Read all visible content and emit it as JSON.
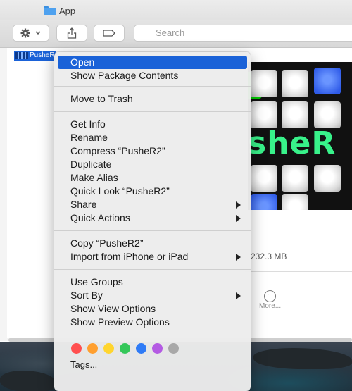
{
  "window": {
    "title": "App",
    "search_placeholder": "Search",
    "selected_file_name": "PusheR2",
    "preview_logo_text": "sheR",
    "file_size": "232.3 MB",
    "more_label": "More..."
  },
  "context_menu": {
    "groups": [
      [
        "Open",
        "Show Package Contents"
      ],
      [
        "Move to Trash"
      ],
      [
        "Get Info",
        "Rename",
        "Compress “PusheR2”",
        "Duplicate",
        "Make Alias",
        "Quick Look “PusheR2”",
        "Share",
        "Quick Actions"
      ],
      [
        "Copy “PusheR2”",
        "Import from iPhone or iPad"
      ],
      [
        "Use Groups",
        "Sort By",
        "Show View Options",
        "Show Preview Options"
      ]
    ],
    "items": {
      "open": "Open",
      "show_package_contents": "Show Package Contents",
      "move_to_trash": "Move to Trash",
      "get_info": "Get Info",
      "rename": "Rename",
      "compress": "Compress “PusheR2”",
      "duplicate": "Duplicate",
      "make_alias": "Make Alias",
      "quick_look": "Quick Look “PusheR2”",
      "share": "Share",
      "quick_actions": "Quick Actions",
      "copy": "Copy “PusheR2”",
      "import_from_iphone": "Import from iPhone or iPad",
      "use_groups": "Use Groups",
      "sort_by": "Sort By",
      "show_view_options": "Show View Options",
      "show_preview_options": "Show Preview Options",
      "tags": "Tags..."
    },
    "selected_item": "Open",
    "tag_colors": [
      "#ff4f4f",
      "#ff9f2f",
      "#ffd52e",
      "#34c759",
      "#2f7bf6",
      "#b45be3",
      "#a8a8a8"
    ],
    "accent_color": "#1a62d8"
  },
  "icons": [
    "folder-icon",
    "gear-icon",
    "chevron-down-icon",
    "share-icon",
    "tag-icon",
    "search-icon",
    "submenu-arrow-icon",
    "more-icon"
  ]
}
